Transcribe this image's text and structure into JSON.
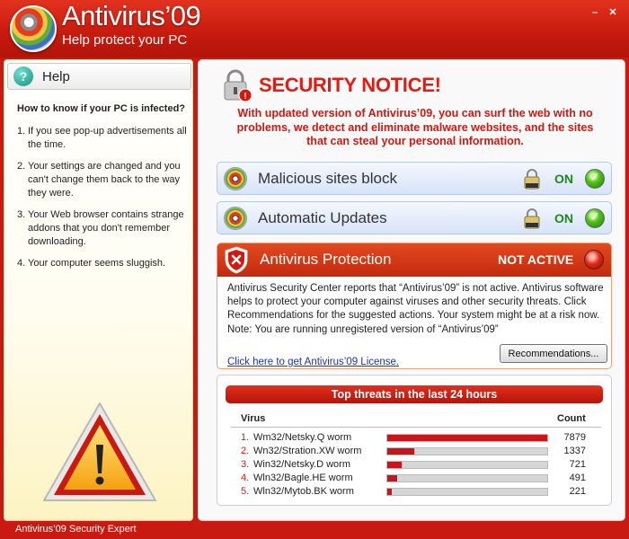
{
  "app": {
    "title": "Antivirus’09",
    "subtitle": "Help protect your PC",
    "window_controls": [
      "–",
      "✕"
    ],
    "footer": "Antivirus’09 Security Expert"
  },
  "help": {
    "title": "Help",
    "question": "How to know if your PC is infected?",
    "items": [
      {
        "num": "1.",
        "text": "If you see pop-up advertisements all the time."
      },
      {
        "num": "2.",
        "text": "Your settings are changed and you can't change them back to the way they were."
      },
      {
        "num": "3.",
        "text": "Your Web browser contains strange addons that you don't remember downloading."
      },
      {
        "num": "4.",
        "text": "Your computer seems sluggish."
      }
    ]
  },
  "notice": {
    "title": "SECURITY NOTICE!",
    "text": "With updated version of Antivirus’09, you can surf the web with no problems, we detect and eliminate malware websites, and the sites that can steal your personal information."
  },
  "features": [
    {
      "label": "Malicious sites block",
      "status": "ON"
    },
    {
      "label": "Automatic Updates",
      "status": "ON"
    }
  ],
  "protection": {
    "label": "Antivirus Protection",
    "status": "NOT ACTIVE",
    "text": "Antivirus Security Center reports that “Antivirus’09” is not active. Antivirus software helps to protect your computer against viruses and other security threats. Click Recommendations for the suggested actions. Your system might be at a risk now.",
    "note": "Note: You are running unregistered version of “Antivirus’09”",
    "button": "Recommendations...",
    "link": "Click here to get Antivirus’09 License."
  },
  "threats": {
    "title": "Top threats in the last 24 hours",
    "col_virus": "Virus",
    "col_count": "Count",
    "rows": [
      {
        "num": "1.",
        "name": "Wm32/Netsky.Q worm",
        "count": "7879"
      },
      {
        "num": "2.",
        "name": "Wn32/Stration.XW worm",
        "count": "1337"
      },
      {
        "num": "3.",
        "name": "Win32/Netsky.D worm",
        "count": "721"
      },
      {
        "num": "4.",
        "name": "Wln32/Bagle.HE worm",
        "count": "491"
      },
      {
        "num": "5.",
        "name": "Wln32/Mytob.BK worm",
        "count": "221"
      }
    ]
  },
  "colors": {
    "brand_red": "#c81a10",
    "on_green": "#1c8a16",
    "link_blue": "#1a33b8"
  }
}
